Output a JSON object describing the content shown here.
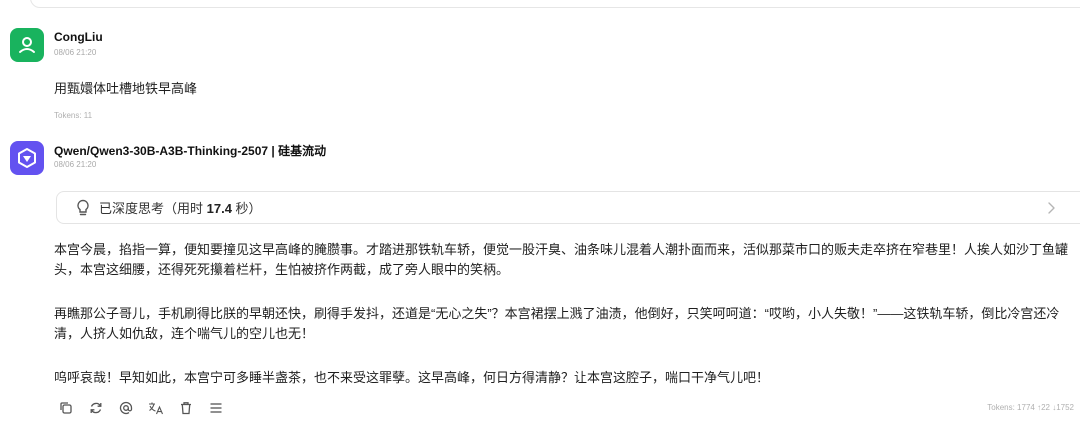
{
  "user_message": {
    "author": "CongLiu",
    "time": "08/06 21:20",
    "text": "用甄嬛体吐槽地铁早高峰",
    "tokens": "Tokens: 11"
  },
  "assistant_message": {
    "author": "Qwen/Qwen3-30B-A3B-Thinking-2507 | 硅基流动",
    "time": "08/06 21:20",
    "thinking": {
      "prefix": "已深度思考（用时 ",
      "seconds": "17.4",
      "suffix": " 秒）"
    },
    "paragraphs": [
      "本宫今晨，掐指一算，便知要撞见这早高峰的腌臜事。才踏进那铁轨车轿，便觉一股汗臭、油条味儿混着人潮扑面而来，活似那菜市口的贩夫走卒挤在窄巷里！人挨人如沙丁鱼罐头，本宫这细腰，还得死死攥着栏杆，生怕被挤作两截，成了旁人眼中的笑柄。",
      "再瞧那公子哥儿，手机刷得比朕的早朝还快，刷得手发抖，还道是“无心之失”？本宫裙摆上溅了油渍，他倒好，只笑呵呵道：“哎哟，小人失敬！”——这铁轨车轿，倒比冷宫还冷清，人挤人如仇敌，连个喘气儿的空儿也无！",
      "呜呼哀哉！早知如此，本宫宁可多睡半盏茶，也不来受这罪孽。这早高峰，何日方得清静？让本宫这腔子，喘口干净气儿吧！"
    ],
    "tokens": "Tokens: 1774 ↑22 ↓1752"
  },
  "toolbar_icons": [
    "copy-icon",
    "regenerate-icon",
    "mention-icon",
    "translate-icon",
    "delete-icon",
    "more-menu-icon"
  ],
  "colors": {
    "user_avatar": "#19b35e",
    "model_avatar": "#6352f0"
  }
}
